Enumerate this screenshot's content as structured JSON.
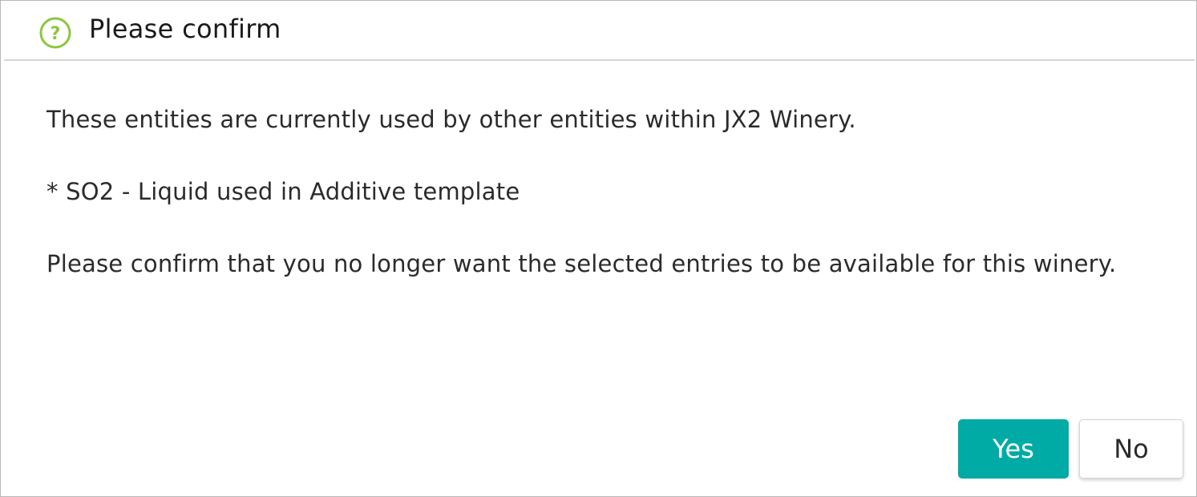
{
  "dialog": {
    "title": "Please confirm",
    "icon": "question-circle-icon",
    "icon_color": "#8cc63f",
    "body": {
      "line1": "These entities are currently used by other entities within JX2 Winery.",
      "line2": "* SO2 - Liquid used in Additive template",
      "line3": "Please confirm that you no longer want the selected entries to be available for this winery."
    },
    "buttons": {
      "yes_label": "Yes",
      "no_label": "No",
      "yes_color": "#00aba5"
    }
  }
}
